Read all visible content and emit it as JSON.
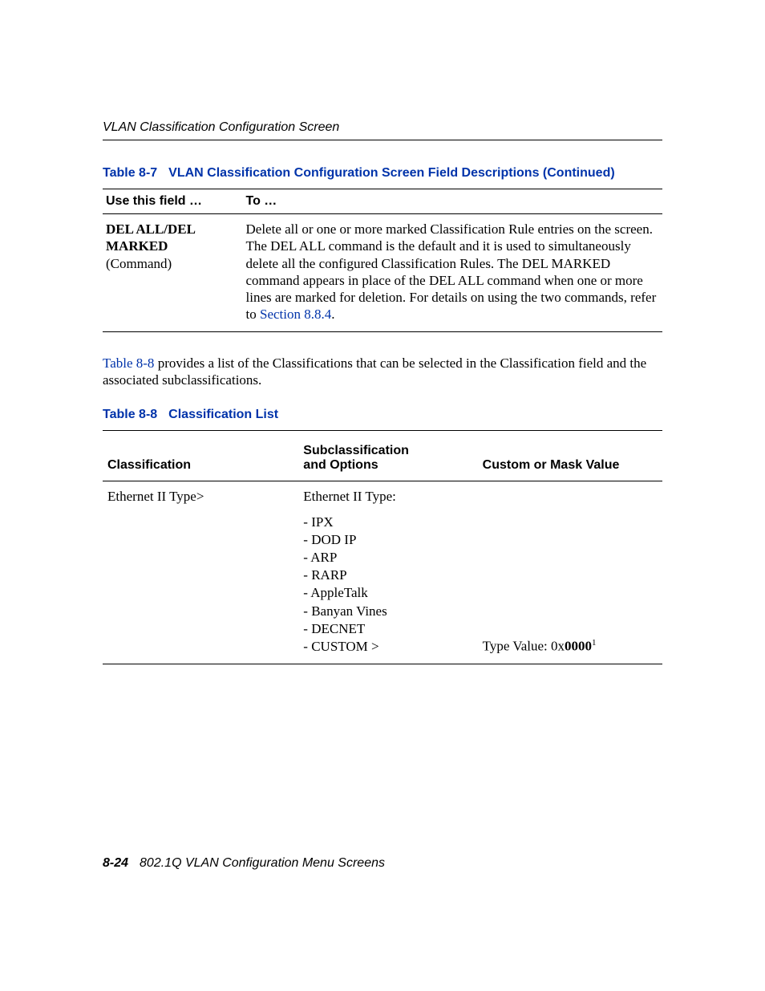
{
  "header": {
    "running": "VLAN Classification Configuration Screen"
  },
  "table87": {
    "caption_num": "Table 8-7",
    "caption_title": "VLAN Classification Configuration Screen Field Descriptions (Continued)",
    "head_col1": "Use this field …",
    "head_col2": "To …",
    "row": {
      "field_l1": "DEL ALL/DEL",
      "field_l2": "MARKED",
      "field_l3": "(Command)",
      "desc_pre": "Delete all or one or more marked Classification Rule entries on the screen. The DEL ALL command is the default and it is used to simultaneously delete all the configured Classification Rules. The DEL MARKED command appears in place of the DEL ALL command when one or more lines are marked for deletion. For details on using the two commands, refer to ",
      "desc_link": "Section 8.8.4",
      "desc_post": "."
    }
  },
  "para": {
    "pre": "",
    "link": "Table 8-8",
    "post": " provides a list of the Classifications that can be selected in the Classification field and the associated subclassifications."
  },
  "table88": {
    "caption_num": "Table 8-8",
    "caption_title": "Classification List",
    "head_c1": "Classification",
    "head_c2_l1": "Subclassification",
    "head_c2_l2": "and Options",
    "head_c3": "Custom or Mask Value",
    "row": {
      "classification": "Ethernet II Type>",
      "sub_head": "Ethernet II Type:",
      "opts": [
        "- IPX",
        "- DOD IP",
        "- ARP",
        "- RARP",
        "- AppleTalk",
        "- Banyan Vines",
        "- DECNET",
        "- CUSTOM >"
      ],
      "custom_label": "Type Value: 0x",
      "custom_bold": "0000",
      "custom_sup": "1"
    }
  },
  "footer": {
    "page": "8-24",
    "title": "802.1Q VLAN Configuration Menu Screens"
  }
}
